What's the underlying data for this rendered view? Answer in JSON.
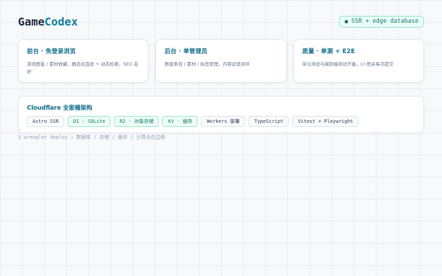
{
  "header": {
    "logo_part1": "Game",
    "logo_part2": "Codex",
    "badge": "SSR + edge database"
  },
  "cards": [
    {
      "title": "前台 · 免登录浏览",
      "desc": "游戏图鉴 / 素材收藏，静态化首屏 + 动态检索，SEO 友好"
    },
    {
      "title": "后台 · 单管理员",
      "desc": "图鉴条目 / 素材 / 标签管理，内容运营闭环"
    },
    {
      "title": "质量 · 单测 + E2E",
      "desc": "单元测试与端到端测试齐备，CI 把关每次提交"
    }
  ],
  "stack": {
    "title": "Cloudflare 全家桶架构",
    "chips": [
      {
        "label": "Astro SSR",
        "highlight": false
      },
      {
        "label": "D1 · SQLite",
        "highlight": true
      },
      {
        "label": "R2 · 对象存储",
        "highlight": true
      },
      {
        "label": "KV · 缓存",
        "highlight": true
      },
      {
        "label": "Workers 部署",
        "highlight": false
      },
      {
        "label": "TypeScript",
        "highlight": false
      },
      {
        "label": "Vitest + Playwright",
        "highlight": false
      }
    ]
  },
  "footer": {
    "command": "$ wrangler deploy → 数据库 / 存储 / 缓存 / 计算全在边缘"
  },
  "colors": {
    "accent": "#0e6b86",
    "highlight_chip": "#0f766e"
  }
}
